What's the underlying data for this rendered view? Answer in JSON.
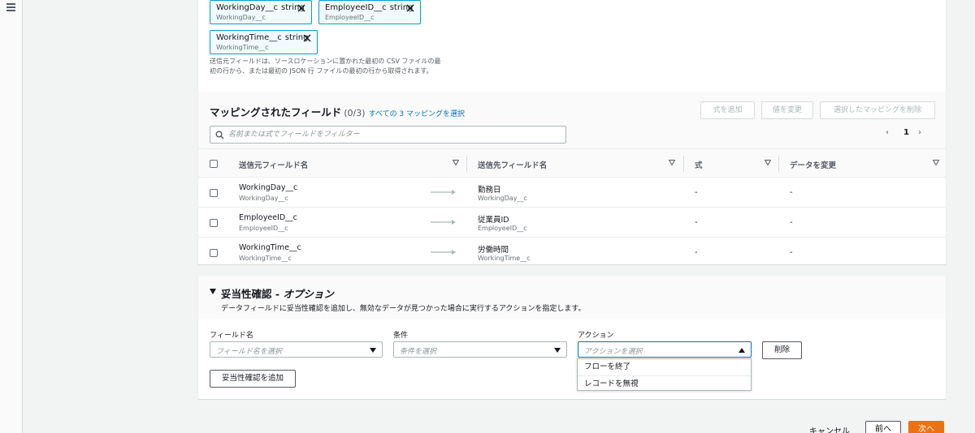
{
  "source_fields": {
    "tokens": [
      {
        "name": "WorkingDay__c",
        "type": "string",
        "sub": "WorkingDay__c"
      },
      {
        "name": "EmployeeID__c",
        "type": "string",
        "sub": "EmployeeID__c"
      },
      {
        "name": "WorkingTime__c",
        "type": "string",
        "sub": "WorkingTime__c"
      }
    ],
    "help_line1": "送信元フィールドは、ソースロケーションに置かれた最初の CSV ファイルの最",
    "help_line2": "初の行から、または最初の JSON 行 ファイルの最初の行から取得されます。"
  },
  "mapping": {
    "title": "マッピングされたフィールド",
    "count": "(0/3)",
    "select_all_link": "すべての 3 マッピングを選択",
    "buttons": {
      "add_formula": "式を追加",
      "modify_values": "値を変更",
      "delete_selected": "選択したマッピングを削除"
    },
    "filter_placeholder": "名前または式でフィールドをフィルター",
    "pager": {
      "prev": "‹",
      "page": "1",
      "next": "›"
    },
    "columns": [
      "送信元フィールド名",
      "送信先フィールド名",
      "式",
      "データを変更"
    ],
    "rows": [
      {
        "src": "WorkingDay__c",
        "src_sub": "WorkingDay__c",
        "dst": "勤務日",
        "dst_sub": "WorkingDay__c",
        "formula": "-",
        "modify": "-"
      },
      {
        "src": "EmployeeID__c",
        "src_sub": "EmployeeID__c",
        "dst": "従業員ID",
        "dst_sub": "EmployeeID__c",
        "formula": "-",
        "modify": "-"
      },
      {
        "src": "WorkingTime__c",
        "src_sub": "WorkingTime__c",
        "dst": "労働時間",
        "dst_sub": "WorkingTime__c",
        "formula": "-",
        "modify": "-"
      }
    ]
  },
  "validation": {
    "title": "妥当性確認 - ",
    "title_option": "オプション",
    "description": "データフィールドに妥当性確認を追加し、無効なデータが見つかった場合に実行するアクションを指定します。",
    "field_label": "フィールド名",
    "field_placeholder": "フィールド名を選択",
    "condition_label": "条件",
    "condition_placeholder": "条件を選択",
    "action_label": "アクション",
    "action_placeholder": "アクションを選択",
    "delete_label": "削除",
    "add_label": "妥当性確認を追加",
    "action_options": [
      "フローを終了",
      "レコードを無視"
    ]
  },
  "footer": {
    "cancel": "キャンセル",
    "prev": "前へ",
    "next": "次へ"
  },
  "colors": {
    "primary": "#ec7211",
    "link": "#0073bb",
    "token_border": "#00a1c9",
    "token_bg": "#f1faff"
  }
}
